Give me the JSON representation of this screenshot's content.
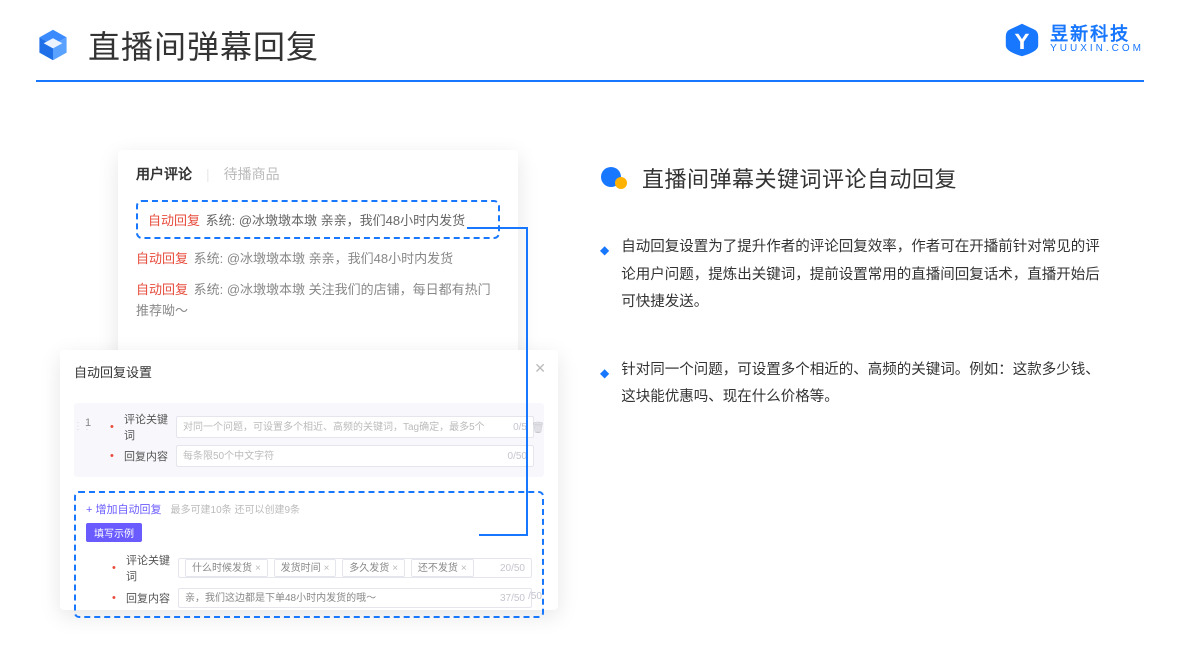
{
  "header": {
    "title": "直播间弹幕回复",
    "brand_cn": "昱新科技",
    "brand_en": "YUUXIN.COM"
  },
  "comments_card": {
    "tab_active": "用户评论",
    "tab_inactive": "待播商品",
    "items": [
      {
        "tag": "自动回复",
        "text": "系统: @冰墩墩本墩 亲亲，我们48小时内发货",
        "highlight": true
      },
      {
        "tag": "自动回复",
        "text": "系统: @冰墩墩本墩 亲亲，我们48小时内发货",
        "highlight": false
      },
      {
        "tag": "自动回复",
        "text": "系统: @冰墩墩本墩 关注我们的店铺，每日都有热门推荐呦～",
        "highlight": false
      }
    ]
  },
  "settings_card": {
    "title": "自动回复设置",
    "index": "1",
    "label_keyword": "评论关键词",
    "placeholder_keyword": "对同一个问题，可设置多个相近、高频的关键词，Tag确定，最多5个",
    "counter_keyword": "0/5",
    "label_content": "回复内容",
    "placeholder_content": "每条限50个中文字符",
    "counter_content": "0/50",
    "add_text": "+ 增加自动回复",
    "add_note": "最多可建10条 还可以创建9条",
    "example_badge": "填写示例",
    "example_keyword_label": "评论关键词",
    "example_tags": [
      "什么时候发货",
      "发货时间",
      "多久发货",
      "还不发货"
    ],
    "example_kw_counter": "20/50",
    "example_content_label": "回复内容",
    "example_content_value": "亲，我们这边都是下单48小时内发货的哦～",
    "example_content_counter": "37/50",
    "bottom_counter": "/50"
  },
  "right": {
    "title": "直播间弹幕关键词评论自动回复",
    "bullets": [
      "自动回复设置为了提升作者的评论回复效率，作者可在开播前针对常见的评论用户问题，提炼出关键词，提前设置常用的直播间回复话术，直播开始后可快捷发送。",
      "针对同一个问题，可设置多个相近的、高频的关键词。例如：这款多少钱、这块能优惠吗、现在什么价格等。"
    ]
  }
}
